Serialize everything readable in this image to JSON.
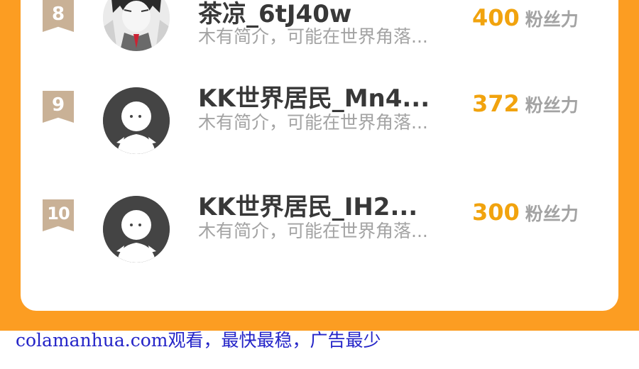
{
  "ranking": [
    {
      "rank": "8",
      "name": "茶凉_6tJ40w",
      "bio": "木有简介，可能在世界角落...",
      "fans": "400",
      "fans_label": "粉丝力",
      "avatar": "manga-character-avatar"
    },
    {
      "rank": "9",
      "name": "KK世界居民_Mn4...",
      "bio": "木有简介，可能在世界角落...",
      "fans": "372",
      "fans_label": "粉丝力",
      "avatar": "default-avatar"
    },
    {
      "rank": "10",
      "name": "KK世界居民_IH2...",
      "bio": "木有简介，可能在世界角落...",
      "fans": "300",
      "fans_label": "粉丝力",
      "avatar": "default-avatar"
    }
  ],
  "watermark": "colamanhua.com观看，最快最稳，广告最少",
  "colors": {
    "background_orange": "#fc9d22",
    "badge": "#c9b196",
    "fan_count": "#f1a30e",
    "name_text": "#383838",
    "muted_text": "#a3a3a3",
    "watermark": "#2525c8"
  }
}
